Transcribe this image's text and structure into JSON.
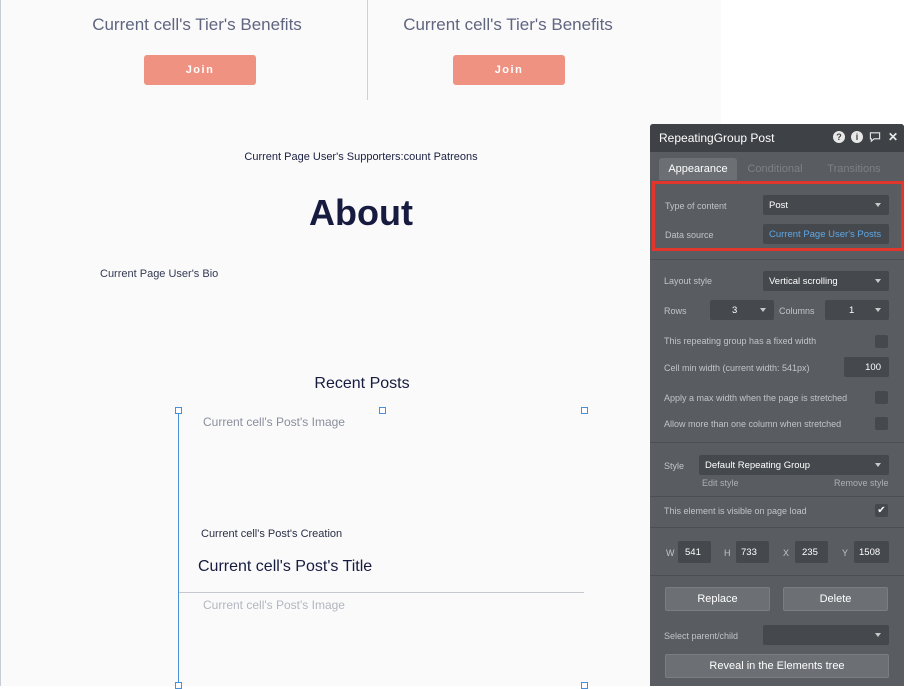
{
  "canvas": {
    "tier_title_left": "Current cell's Tier's Benefits",
    "tier_title_right": "Current cell's Tier's Benefits",
    "join_label_left": "Join",
    "join_label_right": "Join",
    "supporters": "Current Page User's Supporters:count Patreons",
    "about_heading": "About",
    "bio": "Current Page User's Bio",
    "recent_posts_heading": "Recent Posts",
    "post_image_1": "Current cell's Post's Image",
    "post_creation": "Current cell's Post's Creation",
    "post_title": "Current cell's Post's Title",
    "post_image_2": "Current cell's Post's Image"
  },
  "panel": {
    "title": "RepeatingGroup Post",
    "icons": [
      "help-icon",
      "info-icon",
      "comment-icon",
      "close-icon"
    ],
    "tabs": [
      "Appearance",
      "Conditional",
      "Transitions"
    ],
    "type_of_content_label": "Type of content",
    "type_of_content_value": "Post",
    "data_source_label": "Data source",
    "data_source_value": "Current Page User's Posts",
    "layout_style_label": "Layout style",
    "layout_style_value": "Vertical scrolling",
    "rows_label": "Rows",
    "rows_value": "3",
    "columns_label": "Columns",
    "columns_value": "1",
    "fixed_width_label": "This repeating group has a fixed width",
    "cell_min_width_label": "Cell min width (current width: 541px)",
    "cell_min_width_value": "100",
    "max_width_label": "Apply a max width when the page is stretched",
    "multi_column_label": "Allow more than one column when stretched",
    "style_label": "Style",
    "style_value": "Default Repeating Group",
    "edit_style": "Edit style",
    "remove_style": "Remove style",
    "visible_label": "This element is visible on page load",
    "visible_checked": true,
    "w_label": "W",
    "w_value": "541",
    "h_label": "H",
    "h_value": "733",
    "x_label": "X",
    "x_value": "235",
    "y_label": "Y",
    "y_value": "1508",
    "replace_label": "Replace",
    "delete_label": "Delete",
    "select_parent_label": "Select parent/child",
    "reveal_label": "Reveal in the Elements tree"
  },
  "colors": {
    "join_button": "#ef9282",
    "panel_bg": "#595c61",
    "highlight_border": "#e0362c",
    "selection": "#4a90d9",
    "link": "#5fa8e6"
  }
}
